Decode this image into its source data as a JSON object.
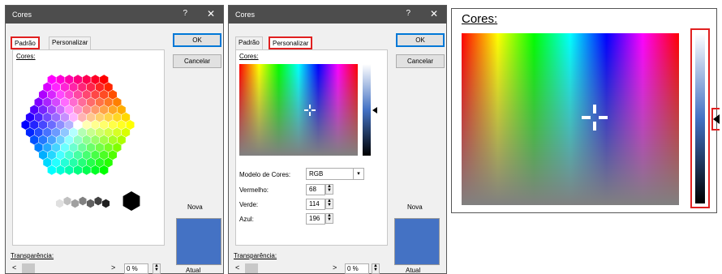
{
  "dialog_standard": {
    "title": "Cores",
    "help": "?",
    "close": "✕",
    "tab_standard": "Padrão",
    "tab_custom": "Personalizar",
    "ok": "OK",
    "cancel": "Cancelar",
    "colors_label": "Cores:",
    "new_label": "Nova",
    "current_label": "Atual",
    "transparency_label": "Transparência:",
    "transparency_value": "0 %",
    "new_color": "#4472c4"
  },
  "dialog_custom": {
    "title": "Cores",
    "help": "?",
    "close": "✕",
    "tab_standard": "Padrão",
    "tab_custom": "Personalizar",
    "ok": "OK",
    "cancel": "Cancelar",
    "colors_label": "Cores:",
    "color_model_label": "Modelo de Cores:",
    "color_model_value": "RGB",
    "red_label": "Vermelho:",
    "red_value": "68",
    "green_label": "Verde:",
    "green_value": "114",
    "blue_label": "Azul:",
    "blue_value": "196",
    "new_label": "Nova",
    "current_label": "Atual",
    "transparency_label": "Transparência:",
    "transparency_value": "0 %",
    "new_color": "#4472c4"
  },
  "zoom": {
    "colors_label": "Cores:"
  },
  "colors": {
    "highlight": "#e02020",
    "titlebar": "#4d4d4d",
    "selected_color": "#4472c4"
  }
}
